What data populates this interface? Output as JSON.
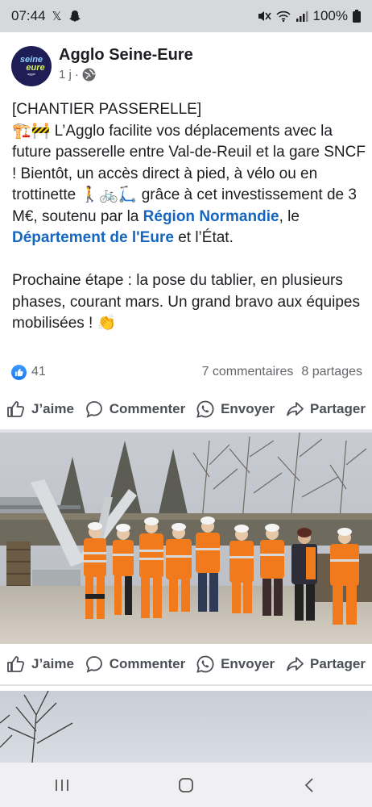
{
  "status_bar": {
    "time": "07:44",
    "battery": "100%"
  },
  "post": {
    "page_name": "Agglo Seine-Eure",
    "avatar_text": {
      "line1": "seine",
      "line2": "eure",
      "line3": "agglo"
    },
    "time_ago": "1 j",
    "separator": "·",
    "text": {
      "line1": "[CHANTIER PASSERELLE]",
      "p1_start": "🏗️🚧 L’Agglo facilite vos déplacements avec la future passerelle entre Val-de-Reuil et la gare SNCF ! Bientôt, un accès direct à pied, à vélo ou en trottinette 🚶🚲🛴 grâce à cet investissement de 3 M€, soutenu par la ",
      "link1": "Région Normandie",
      "p1_mid": ", le ",
      "link2": "Département de l'Eure",
      "p1_end": " et l’État.",
      "p2": "Prochaine étape : la pose du tablier, en plusieurs phases, courant mars. Un grand bravo aux équipes mobilisées ! 👏"
    },
    "reactions_count": "41",
    "comments_count": "7 commentaires",
    "shares_count": "8 partages"
  },
  "actions": {
    "like": "J’aime",
    "comment": "Commenter",
    "send": "Envoyer",
    "share": "Partager"
  },
  "colors": {
    "link": "#1566c0",
    "like_blue": "#1877f2",
    "background": "#dfe1e5"
  }
}
